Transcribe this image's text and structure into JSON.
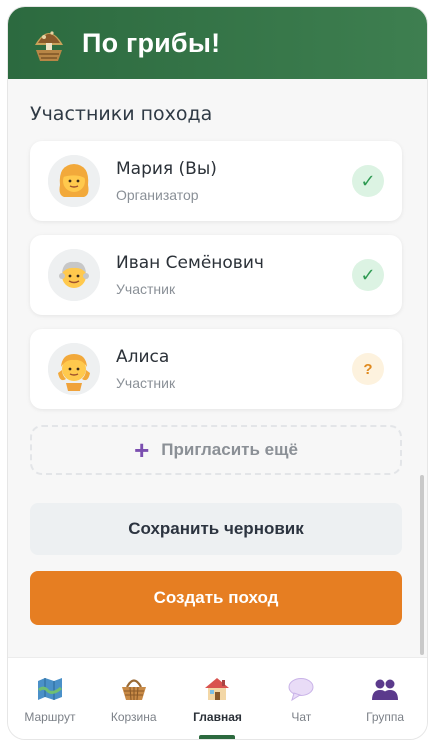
{
  "header": {
    "title": "По грибы!",
    "logo_icon": "mushroom-basket-icon"
  },
  "participants": {
    "title": "Участники похода",
    "items": [
      {
        "name": "Мария (Вы)",
        "role": "Организатор",
        "status": "✓",
        "status_type": "confirmed",
        "avatar": "woman-avatar"
      },
      {
        "name": "Иван Семёнович",
        "role": "Участник",
        "status": "✓",
        "status_type": "confirmed",
        "avatar": "old-man-avatar"
      },
      {
        "name": "Алиса",
        "role": "Участник",
        "status": "?",
        "status_type": "pending",
        "avatar": "child-avatar"
      }
    ],
    "invite_label": "Пригласить ещё"
  },
  "actions": {
    "draft_label": "Сохранить черновик",
    "create_label": "Создать поход"
  },
  "tabs": [
    {
      "label": "Маршрут",
      "icon": "map-icon",
      "active": false
    },
    {
      "label": "Корзина",
      "icon": "basket-icon",
      "active": false
    },
    {
      "label": "Главная",
      "icon": "home-icon",
      "active": true
    },
    {
      "label": "Чат",
      "icon": "chat-bubble-icon",
      "active": false
    },
    {
      "label": "Группа",
      "icon": "group-icon",
      "active": false
    }
  ],
  "colors": {
    "header": "#2c6a3f",
    "accent": "#e67e22",
    "confirmed": "#2e9a52",
    "pending": "#e08a1f"
  }
}
